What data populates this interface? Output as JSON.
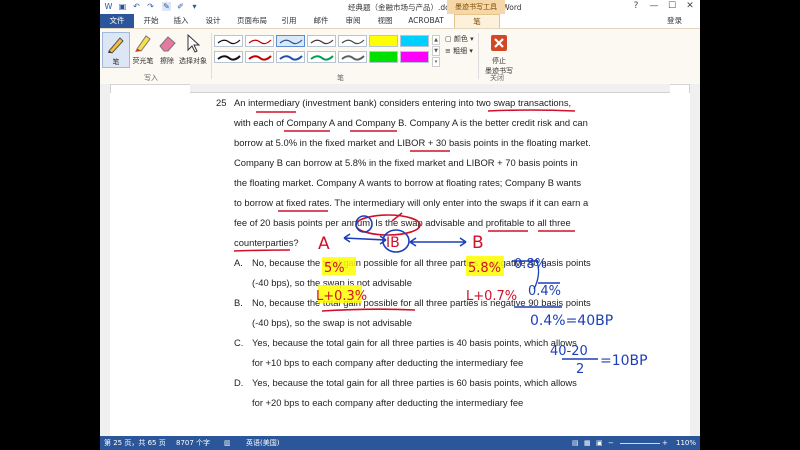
{
  "window": {
    "title": "经典题（金融市场与产品）.docx - Microsoft Word",
    "context_tab": "墨迹书写工具",
    "controls": [
      "?",
      "—",
      "☐",
      "✕"
    ]
  },
  "tabs": {
    "file": "文件",
    "items": [
      "开始",
      "插入",
      "设计",
      "页面布局",
      "引用",
      "邮件",
      "审阅",
      "视图",
      "ACROBAT"
    ],
    "active": "笔",
    "login": "登录"
  },
  "ribbon": {
    "write_tools": [
      "笔",
      "荧光笔",
      "擦除",
      "选择对象"
    ],
    "write_group": "写入",
    "pens_group": "笔",
    "color_label": "颜色",
    "thickness_label": "粗细",
    "stop_label_1": "停止",
    "stop_label_2": "墨迹书写",
    "close_group": "关闭",
    "pen_colors": [
      "#111111",
      "#c00000",
      "#2f5597",
      "#3a3a3a",
      "#4a4a4a",
      "#ffff00",
      "#00d0ff",
      "#111111",
      "#c00000",
      "#1f4fb0",
      "#00a050",
      "#606060",
      "#00e000",
      "#ff00ff"
    ]
  },
  "question": {
    "number": "25",
    "lines": [
      "An intermediary (investment bank) considers entering into two swap transactions,",
      "with each of Company A and Company B. Company A is the better credit risk and can",
      "borrow at 5.0% in the fixed market and LIBOR + 30 basis points in the floating market.",
      "Company B can borrow at 5.8% in the fixed market and LIBOR + 70 basis points in",
      "the floating market. Company A wants to borrow at floating rates; Company B wants",
      "to borrow at fixed rates. The intermediary will only enter into the swaps if it can earn a",
      "fee of 20 basis points per annum. Is the swap advisable and profitable to all three",
      "counterparties?"
    ]
  },
  "options": [
    {
      "letter": "A.",
      "line1": "No, because the total gain possible for all three parties is negative 40 basis points",
      "line2": "(-40 bps), so the swap is not advisable"
    },
    {
      "letter": "B.",
      "line1": "No, because the total gain possible for all three parties is negative 90 basis points",
      "line2": "(-40 bps), so the swap is not advisable"
    },
    {
      "letter": "C.",
      "line1": "Yes, because the total gain for all three parties is 40 basis points, which allows",
      "line2": "for +10 bps to each company after deducting the intermediary fee"
    },
    {
      "letter": "D.",
      "line1": "Yes, because the total gain for all three parties is 60 basis points, which allows",
      "line2": "for +20 bps to each company after deducting the intermediary fee"
    }
  ],
  "ink": {
    "node_a": "A",
    "node_ib": "IB",
    "node_b": "B",
    "a_fixed": "5%",
    "a_float": "L+0.3%",
    "b_fixed": "5.8%",
    "b_float": "L+0.7%",
    "diff_fixed": "0.8%",
    "diff_float": "0.4%",
    "net": "0.4%=40BP",
    "frac_num": "40-20",
    "frac_den": "2",
    "result": "=10BP"
  },
  "status": {
    "page": "第 25 页，共 65 页",
    "words": "8707 个字",
    "language": "英语(美国)",
    "zoom": "110%"
  }
}
